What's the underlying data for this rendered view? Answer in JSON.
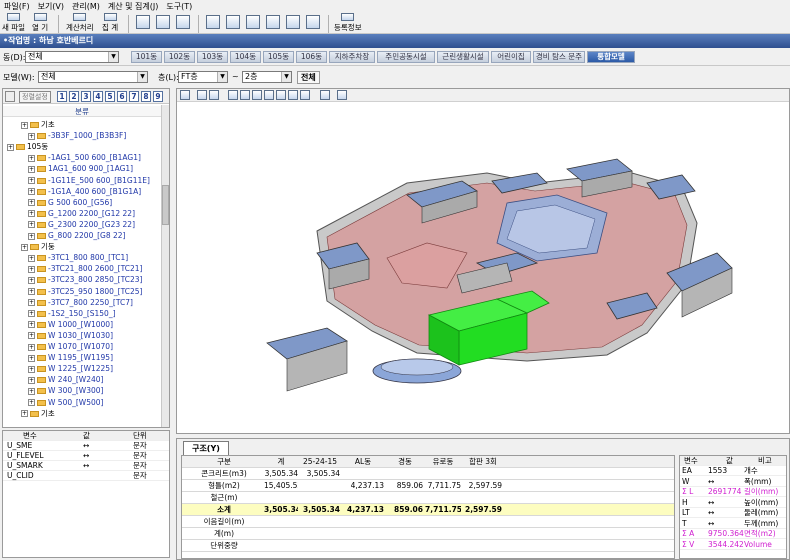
{
  "menu": [
    "파일(F)",
    "보기(V)",
    "관리(M)",
    "계산 및 집계(J)",
    "도구(T)"
  ],
  "toolbar": {
    "new": "새 파일",
    "open": "열  기",
    "calc": "계산처리",
    "sum": "집  계",
    "reg": "등록정보"
  },
  "title": "•작업명 : 하남 호반베르디",
  "dong_label": "동(D):",
  "dong_value": "전체",
  "tabs": [
    "101동",
    "102동",
    "103동",
    "104동",
    "105동",
    "106동",
    "지하주차장",
    "주민공동시설",
    "근린생활시설",
    "어린이집",
    "경비 탐스 문주",
    "통합모델"
  ],
  "active_tab": 11,
  "filter": {
    "model_label": "모델(W):",
    "model_value": "전체",
    "floor_label": "층(L):",
    "floor_from": "FT층",
    "tilde": "~",
    "floor_to": "2층",
    "all_btn": "전체"
  },
  "left_toolbar": {
    "sort": "정렬설정",
    "nums": [
      "1",
      "2",
      "3",
      "4",
      "5",
      "6",
      "7",
      "8",
      "9"
    ]
  },
  "tree_header": "분류",
  "tree": [
    {
      "t": "기초",
      "cat": true,
      "lv": 2
    },
    {
      "t": "-3B3F_1000_[B3B3F]",
      "lv": 3
    },
    {
      "t": "105동",
      "cat": true,
      "lv": 0
    },
    {
      "t": "-1AG1_500 600_[B1AG1]",
      "lv": 3
    },
    {
      "t": "1AG1_600 900_[1AG1]",
      "lv": 3
    },
    {
      "t": "-1G11E_500 600_[B1G11E]",
      "lv": 3
    },
    {
      "t": "-1G1A_400 600_[B1G1A]",
      "lv": 3
    },
    {
      "t": "G 500 600_[G56]",
      "lv": 3
    },
    {
      "t": "G_1200 2200_[G12 22]",
      "lv": 3
    },
    {
      "t": "G_2300 2200_[G23 22]",
      "lv": 3
    },
    {
      "t": "G_800 2200_[G8 22]",
      "lv": 3
    },
    {
      "t": "기둥",
      "cat": true,
      "lv": 2
    },
    {
      "t": "-3TC1_800 800_[TC1]",
      "lv": 3
    },
    {
      "t": "-3TC21_800 2600_[TC21]",
      "lv": 3
    },
    {
      "t": "-3TC23_800 2850_[TC23]",
      "lv": 3
    },
    {
      "t": "-3TC25_950 1800_[TC25]",
      "lv": 3
    },
    {
      "t": "-3TC7_800 2250_[TC7]",
      "lv": 3
    },
    {
      "t": "-1S2_150_[S150_]",
      "lv": 3
    },
    {
      "t": "W 1000_[W1000]",
      "lv": 3
    },
    {
      "t": "W 1030_[W1030]",
      "lv": 3
    },
    {
      "t": "W 1070_[W1070]",
      "lv": 3
    },
    {
      "t": "W 1195_[W1195]",
      "lv": 3
    },
    {
      "t": "W 1225_[W1225]",
      "lv": 3
    },
    {
      "t": "W 240_[W240]",
      "lv": 3
    },
    {
      "t": "W 300_[W300]",
      "lv": 3
    },
    {
      "t": "W 500_[W500]",
      "lv": 3
    },
    {
      "t": "기초",
      "cat": true,
      "lv": 2
    }
  ],
  "props": {
    "headers": [
      "변수",
      "값",
      "단위"
    ],
    "rows": [
      [
        "U_SME",
        "↔",
        "문자"
      ],
      [
        "U_FLEVEL",
        "↔",
        "문자"
      ],
      [
        "U_SMARK",
        "↔",
        "문자"
      ],
      [
        "U_CLID",
        "",
        "문자"
      ]
    ]
  },
  "bottom_tab": "구조(Y)",
  "grid": {
    "headers": [
      "구분",
      "계",
      "25-24-15",
      "AL동",
      "경동",
      "유로동",
      "합판 3회"
    ],
    "rows": [
      [
        "콘크리트(m3)",
        "3,505.34",
        "3,505.34",
        "",
        "",
        "",
        ""
      ],
      [
        "형틀(m2)",
        "15,405.52",
        "",
        "4,237.13",
        "859.06",
        "7,711.75",
        "2,597.59"
      ],
      [
        "철근(m)",
        "",
        "",
        "",
        "",
        "",
        ""
      ],
      [
        "소계",
        "3,505.34",
        "3,505.34",
        "4,237.13",
        "859.06",
        "7,711.75",
        "2,597.59"
      ],
      [
        "이음길이(m)",
        "",
        "",
        "",
        "",
        "",
        ""
      ],
      [
        "계(m)",
        "",
        "",
        "",
        "",
        "",
        ""
      ],
      [
        "단위중량",
        "",
        "",
        "",
        "",
        "",
        ""
      ]
    ]
  },
  "right": {
    "headers": [
      "변수",
      "값",
      "비고"
    ],
    "rows": [
      [
        "EA",
        "1553",
        "개수"
      ],
      [
        "W",
        "↔",
        "폭(mm)"
      ],
      [
        "Σ L",
        "2691774",
        "길이(mm)"
      ],
      [
        "H",
        "↔",
        "높이(mm)"
      ],
      [
        "LT",
        "↔",
        "둘레(mm)"
      ],
      [
        "T",
        "↔",
        "두께(mm)"
      ],
      [
        "Σ A",
        "9750.364",
        "면적(m2)"
      ],
      [
        "Σ V",
        "3544.242",
        "Volume"
      ]
    ]
  },
  "colors": {
    "titlebar": "#2e4f8f",
    "active_tab": "#2c5aa6",
    "slab": "#dba0a0",
    "roof": "#7f98c8",
    "green": "#22dd22",
    "tree_text": "#2037a8",
    "highlight": "#fdfdc0"
  }
}
